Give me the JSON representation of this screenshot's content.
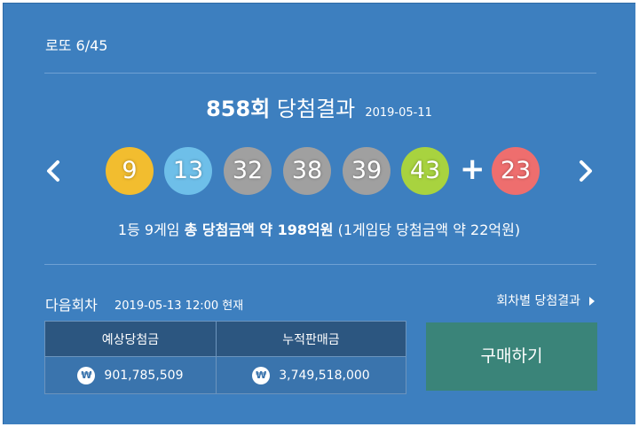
{
  "header": {
    "game_name": "로또 6/45"
  },
  "draw": {
    "round": "858회",
    "title_suffix": " 당첨결과",
    "date": "2019-05-11",
    "balls": [
      {
        "num": "9",
        "color": "#f2bd2f"
      },
      {
        "num": "13",
        "color": "#6ebfe9"
      },
      {
        "num": "32",
        "color": "#a0a0a0"
      },
      {
        "num": "38",
        "color": "#a0a0a0"
      },
      {
        "num": "39",
        "color": "#a0a0a0"
      },
      {
        "num": "43",
        "color": "#a8d33f"
      }
    ],
    "plus_symbol": "+",
    "bonus": {
      "num": "23",
      "color": "#ee6e6e"
    },
    "prize_lead": "1등 9게임 ",
    "prize_bold": "총 당첨금액 약 198억원",
    "prize_tail": " (1게임당 당첨금액 약 22억원)"
  },
  "next": {
    "label": "다음회차",
    "datetime": "2019-05-13 12:00 현재",
    "results_link": "회차별 당첨결과",
    "table": {
      "headers": [
        "예상당첨금",
        "누적판매금"
      ],
      "values": [
        "901,785,509",
        "3,749,518,000"
      ],
      "currency_symbol": "₩"
    },
    "buy_label": "구매하기"
  },
  "colors": {
    "panel": "#3d7fbf",
    "table_header": "#2c5680",
    "buy_button": "#3a8479"
  }
}
